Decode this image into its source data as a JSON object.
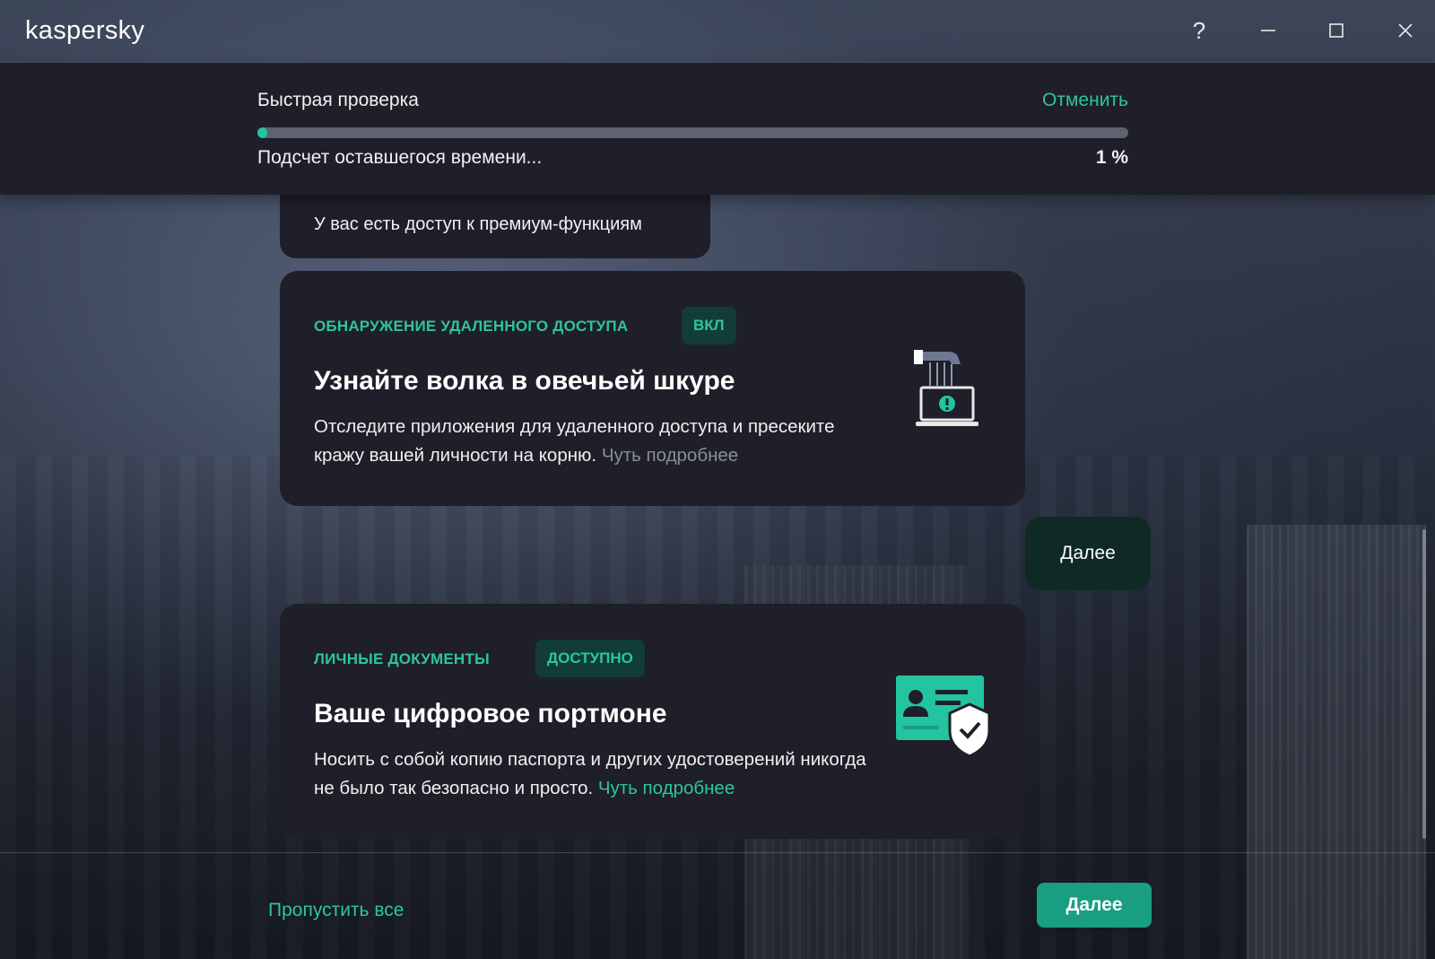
{
  "app": {
    "logo": "kaspersky"
  },
  "window_controls": {
    "help": "?"
  },
  "scan": {
    "title": "Быстрая проверка",
    "cancel_label": "Отменить",
    "status": "Подсчет оставшегося времени...",
    "percent_label": "1 %",
    "progress_fraction": 0.01
  },
  "premium_notice": "У вас есть доступ к премиум-функциям",
  "cards": [
    {
      "category": "ОБНАРУЖЕНИЕ УДАЛЕННОГО ДОСТУПА",
      "badge": "ВКЛ",
      "heading": "Узнайте волка в овечьей шкуре",
      "description": "Отследите приложения для удаленного доступа и пресеките кражу вашей личности на корню.",
      "link": "Чуть подробнее",
      "icon": "remote-access-laptop-icon"
    },
    {
      "category": "ЛИЧНЫЕ ДОКУМЕНТЫ",
      "badge": "ДОСТУПНО",
      "heading": "Ваше цифровое портмоне",
      "description": "Носить с собой копию паспорта и других удостоверений никогда не было так безопасно и просто.",
      "link": "Чуть подробнее",
      "icon": "id-card-shield-icon"
    }
  ],
  "float_next_label": "Далее",
  "footer": {
    "skip_all_label": "Пропустить все",
    "next_label": "Далее"
  },
  "colors": {
    "accent": "#2ec4a0",
    "primary_button": "#1a9e81",
    "panel": "#1e1f28",
    "badge_bg": "#113d36"
  }
}
